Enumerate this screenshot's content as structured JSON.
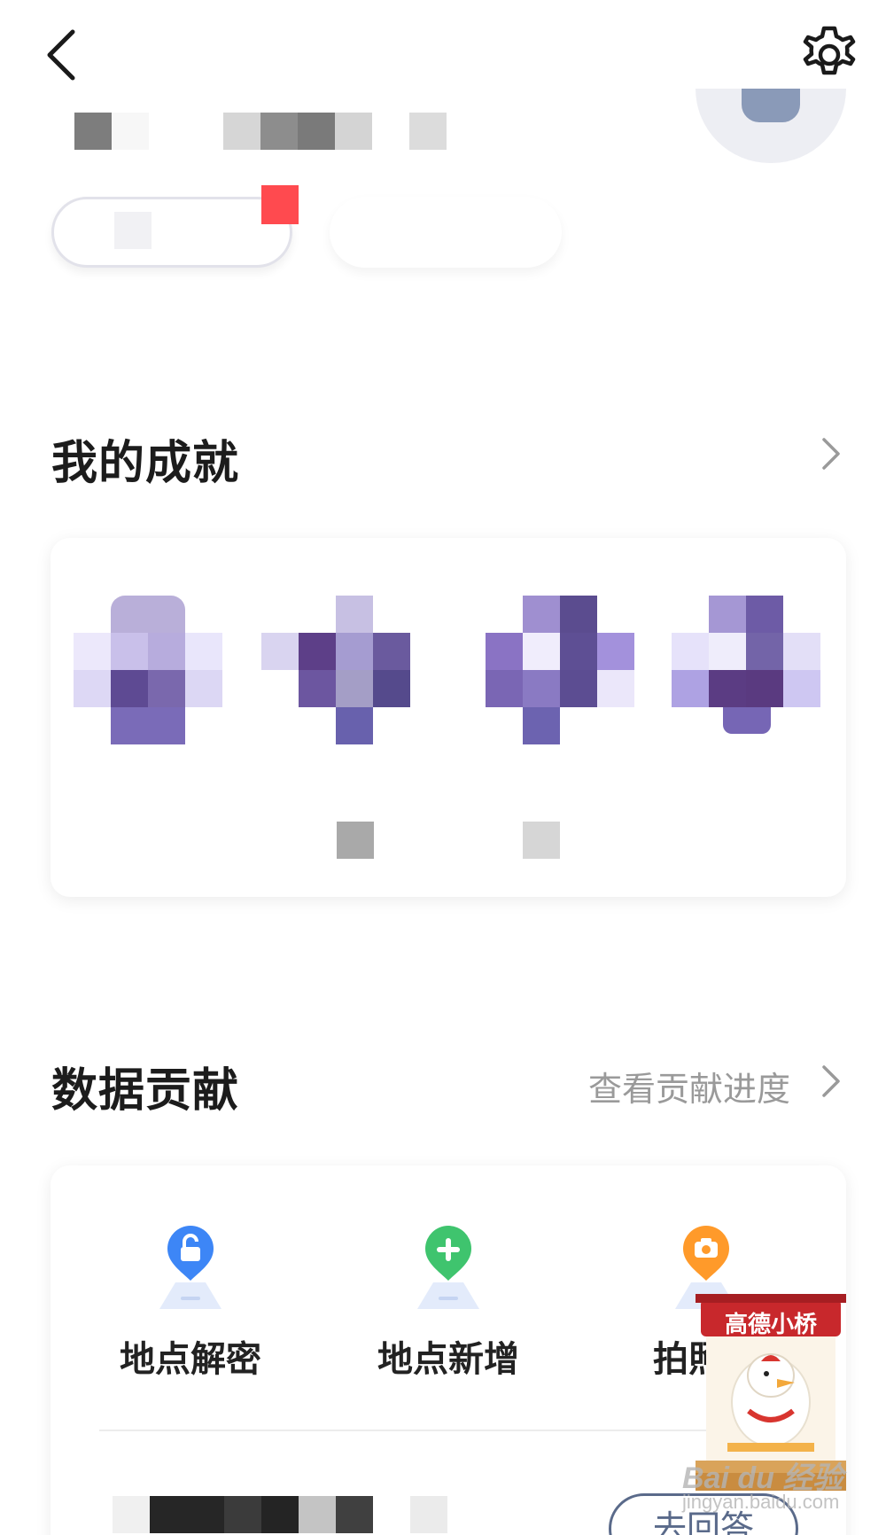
{
  "topbar": {
    "back_icon": "chevron-left-icon",
    "settings_icon": "gear-icon"
  },
  "achievements": {
    "title": "我的成就",
    "chevron_icon": "chevron-right-icon"
  },
  "data_contribution": {
    "title": "数据贡献",
    "progress_link": "查看贡献进度",
    "chevron_icon": "chevron-right-icon",
    "items": [
      {
        "label": "地点解密",
        "icon": "unlock-pin-icon",
        "color": "#3d86f6"
      },
      {
        "label": "地点新增",
        "icon": "plus-pin-icon",
        "color": "#3fc46e"
      },
      {
        "label": "拍照验",
        "icon": "camera-pin-icon",
        "color": "#ff9a2a"
      }
    ],
    "answer_button": "去回答"
  },
  "mascot_ad": {
    "title": "高德小桥"
  },
  "watermark": {
    "text": "Bai du 经验",
    "sub": "jingyan.baidu.com"
  },
  "colors": {
    "accent_red": "#ff4a4f",
    "badge_purple": "#6d5ba6",
    "text_muted": "#9a9a9a"
  }
}
